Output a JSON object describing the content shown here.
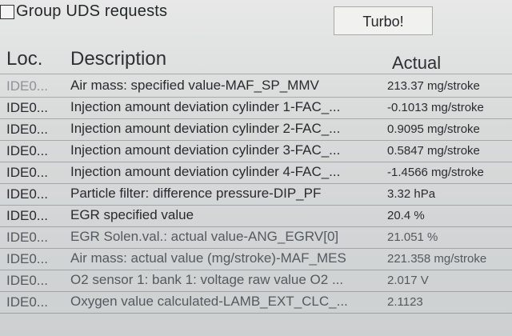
{
  "toolbar": {
    "group_label": "Group UDS requests",
    "turbo_label": "Turbo!"
  },
  "table": {
    "headers": {
      "loc": "Loc.",
      "description": "Description",
      "actual": "Actual"
    },
    "rows": [
      {
        "loc": "IDE0...",
        "description": "Air mass: specified value-MAF_SP_MMV",
        "actual": "213.37 mg/stroke"
      },
      {
        "loc": "IDE0...",
        "description": "Injection amount deviation cylinder 1-FAC_...",
        "actual": "-0.1013 mg/stroke"
      },
      {
        "loc": "IDE0...",
        "description": "Injection amount deviation cylinder 2-FAC_...",
        "actual": "0.9095 mg/stroke"
      },
      {
        "loc": "IDE0...",
        "description": "Injection amount deviation cylinder 3-FAC_...",
        "actual": "0.5847 mg/stroke"
      },
      {
        "loc": "IDE0...",
        "description": "Injection amount deviation cylinder 4-FAC_...",
        "actual": "-1.4566 mg/stroke"
      },
      {
        "loc": "IDE0...",
        "description": "Particle filter: difference pressure-DIP_PF",
        "actual": "3.32 hPa"
      },
      {
        "loc": "IDE0...",
        "description": "EGR specified value",
        "actual": "20.4 %"
      },
      {
        "loc": "IDE0...",
        "description": "EGR Solen.val.: actual value-ANG_EGRV[0]",
        "actual": "21.051 %"
      },
      {
        "loc": "IDE0...",
        "description": "Air mass: actual value (mg/stroke)-MAF_MES",
        "actual": "221.358 mg/stroke"
      },
      {
        "loc": "IDE0...",
        "description": "O2 sensor 1: bank 1: voltage raw value O2 ...",
        "actual": "2.017 V"
      },
      {
        "loc": "IDE0...",
        "description": "Oxygen value calculated-LAMB_EXT_CLC_...",
        "actual": "2.1123"
      }
    ]
  }
}
